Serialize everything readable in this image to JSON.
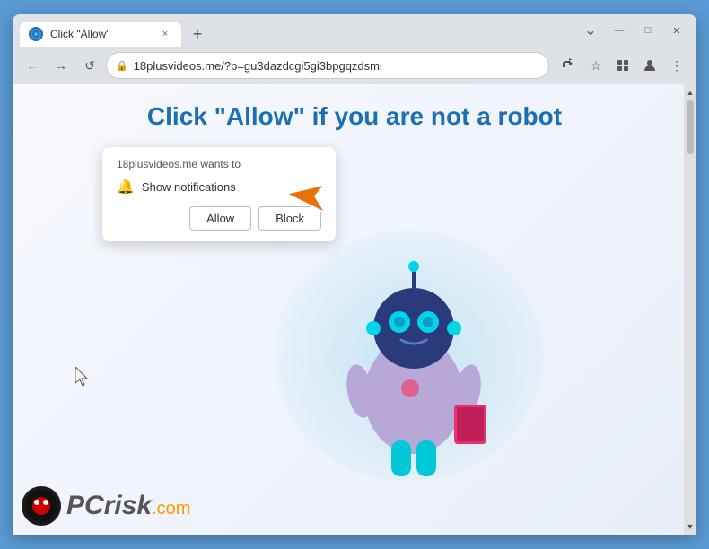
{
  "window": {
    "title": "Click \"Allow\"",
    "close_label": "×",
    "minimize_label": "—",
    "maximize_label": "□",
    "chevron_down_label": "⌄",
    "new_tab_label": "+"
  },
  "tabs": [
    {
      "title": "Click \"Allow\"",
      "active": true
    }
  ],
  "address_bar": {
    "url": "18plusvideos.me/?p=gu3dazdcgi5gi3bpgqzdsmi",
    "lock_symbol": "🔒"
  },
  "toolbar_icons": {
    "share": "⬆",
    "star": "☆",
    "extensions": "⬛",
    "profile": "👤",
    "menu": "⋮",
    "back": "←",
    "forward": "→",
    "refresh": "↺"
  },
  "page": {
    "headline": "Click \"Allow\" if you are not a robot",
    "permission_popup": {
      "site": "18plusvideos.me wants to",
      "label": "Show notifications",
      "allow_label": "Allow",
      "block_label": "Block"
    }
  },
  "watermark": {
    "pc_text": "PC",
    "risk_text": "risk",
    "com_text": ".com"
  },
  "colors": {
    "headline_blue": "#1a6fb5",
    "allow_bg": "#ffffff",
    "block_bg": "#ffffff",
    "browser_chrome": "#dee1e6",
    "orange_arrow": "#e8710a"
  }
}
